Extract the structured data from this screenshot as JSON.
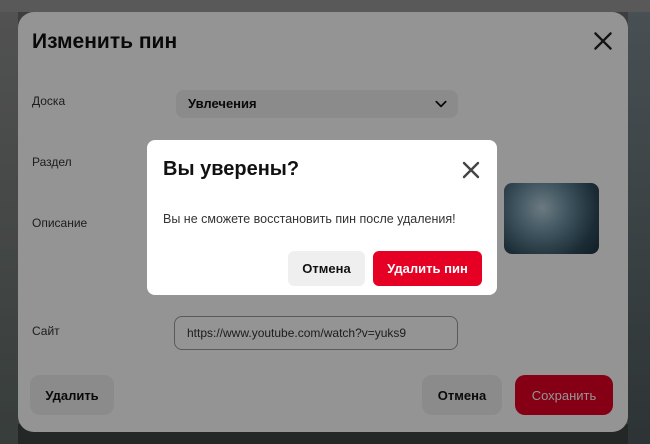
{
  "edit_modal": {
    "title": "Изменить пин",
    "fields": {
      "board_label": "Доска",
      "board_value": "Увлечения",
      "section_label": "Раздел",
      "description_label": "Описание",
      "site_label": "Сайт",
      "site_value": "https://www.youtube.com/watch?v=yuks9"
    },
    "buttons": {
      "delete": "Удалить",
      "cancel": "Отмена",
      "save": "Сохранить"
    }
  },
  "confirm_dialog": {
    "title": "Вы уверены?",
    "message": "Вы не сможете восстановить пин после удаления!",
    "cancel_label": "Отмена",
    "delete_label": "Удалить пин"
  },
  "colors": {
    "accent_red": "#e60023",
    "secondary_button": "#efefef",
    "overlay": "rgba(0,0,0,0.42)"
  },
  "icons": {
    "close": "close-icon",
    "chevron": "chevron-down-icon"
  }
}
